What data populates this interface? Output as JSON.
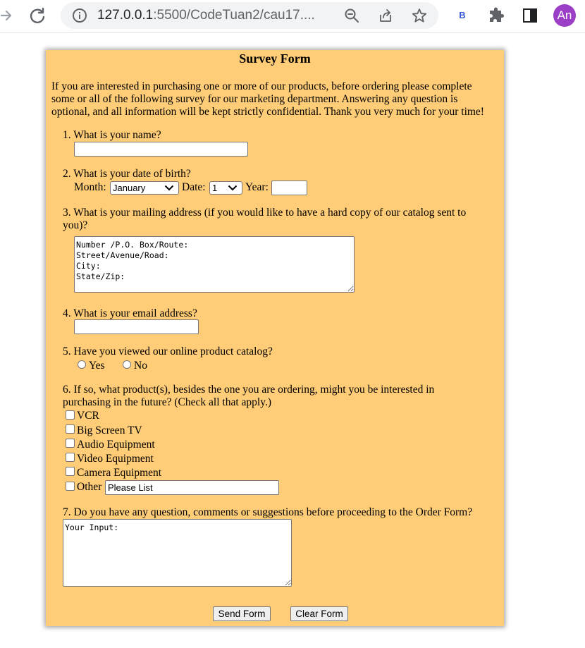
{
  "browser": {
    "url_host": "127.0.0.1",
    "url_rest": ":5500/CodeTuan2/cau17....",
    "extension_label": "B",
    "profile_initials": "An"
  },
  "form": {
    "title": "Survey Form",
    "intro_lines": [
      "If you are interested in purchasing one or more of our products, before ordering please complete",
      "some or all of the following survey for our marketing department. Answering any question is",
      "optional, and all information will be kept strictly confidential. Thank you very much for your time!"
    ],
    "q1": {
      "label": "1. What is your name?",
      "value": ""
    },
    "q2": {
      "label": "2. What is your date of birth?",
      "month_label": "Month:",
      "month_value": "January",
      "date_label": "Date:",
      "date_value": "1",
      "year_label": "Year:",
      "year_value": ""
    },
    "q3": {
      "label_line1": "3. What is your mailing address (if you would like to have a hard copy of our catalog sent to",
      "label_line2": "you)?",
      "textarea_value": "Number /P.O. Box/Route:\nStreet/Avenue/Road:\nCity:\nState/Zip:"
    },
    "q4": {
      "label": "4. What is your email address?",
      "value": ""
    },
    "q5": {
      "label": "5. Have you viewed our online product catalog?",
      "option_yes": "Yes",
      "option_no": "No"
    },
    "q6": {
      "label_line1": "6. If so, what product(s), besides the one you are ordering, might you be interested in",
      "label_line2": "purchasing in the future? (Check all that apply.)",
      "options": [
        "VCR",
        "Big Screen TV",
        "Audio Equipment",
        "Video Equipment",
        "Camera Equipment",
        "Other"
      ],
      "other_value": "Please List"
    },
    "q7": {
      "label": "7. Do you have any question, comments or suggestions before proceeding to the Order Form?",
      "textarea_value": "Your Input:"
    },
    "send_label": "Send Form",
    "clear_label": "Clear Form"
  }
}
